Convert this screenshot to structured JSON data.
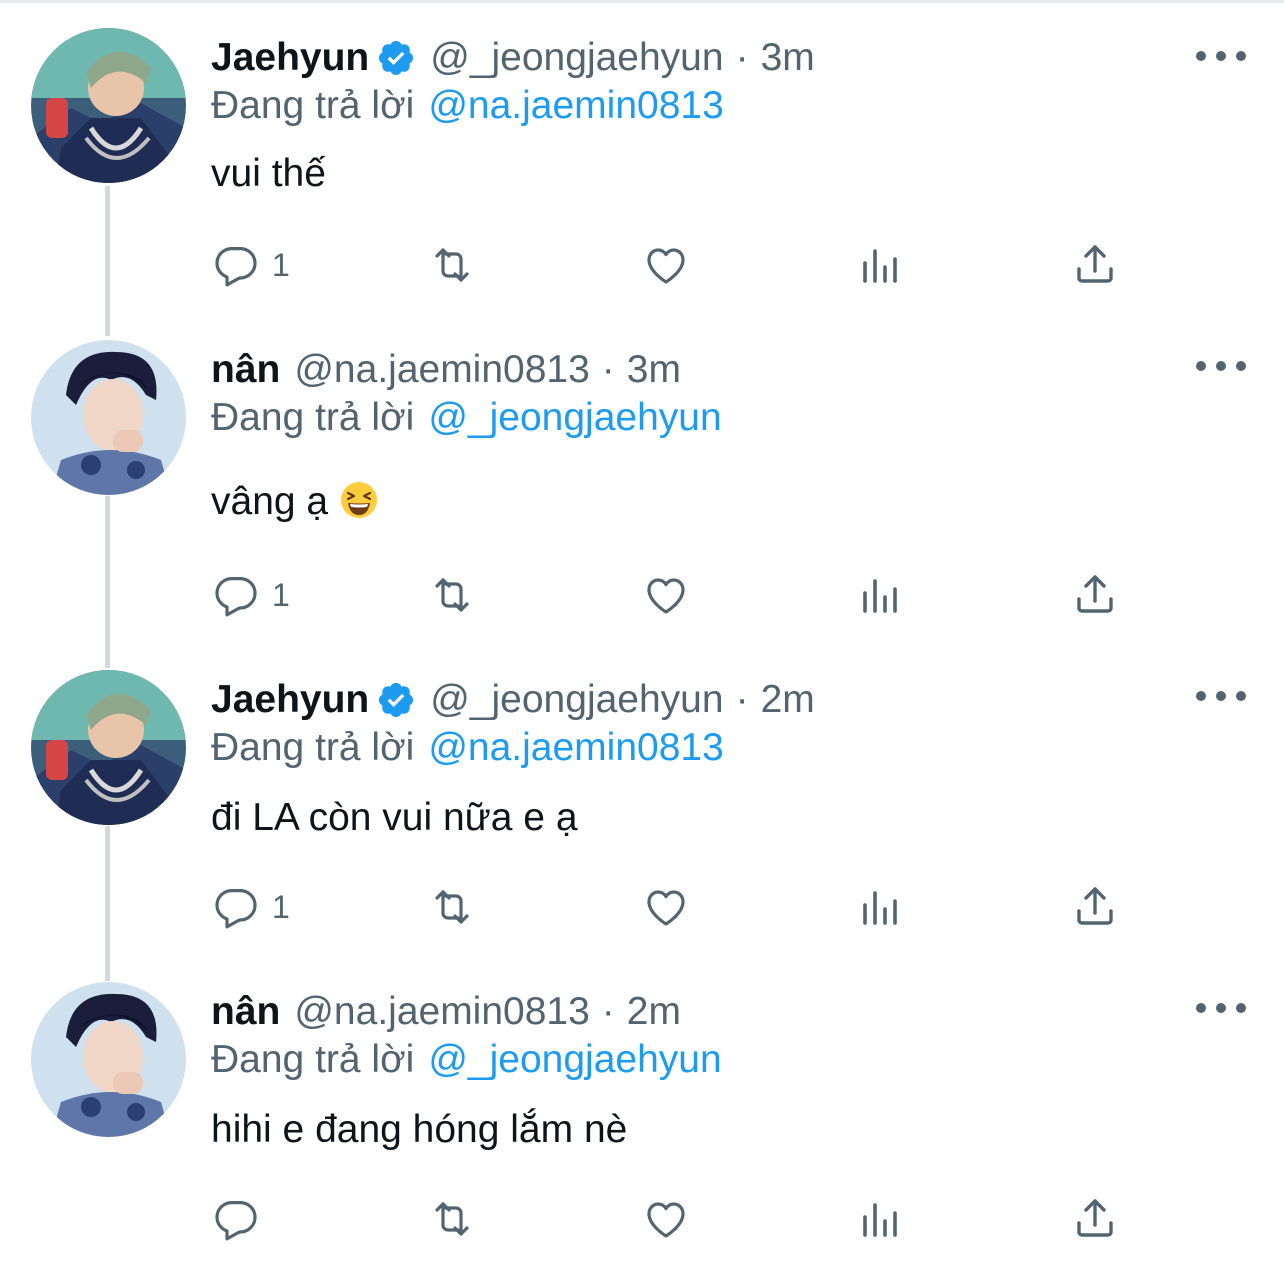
{
  "tweets": [
    {
      "display_name": "Jaehyun",
      "verified": true,
      "handle": "@_jeongjaehyun",
      "separator": "·",
      "time": "3m",
      "reply_prefix": "Đang trả lời",
      "reply_to": "@na.jaemin0813",
      "text": "vui thế",
      "reply_count": "1"
    },
    {
      "display_name": "nân",
      "verified": false,
      "handle": "@na.jaemin0813",
      "separator": "·",
      "time": "3m",
      "reply_prefix": "Đang trả lời",
      "reply_to": "@_jeongjaehyun",
      "text": "vâng ạ",
      "emoji": "grinning-squinting-face",
      "reply_count": "1"
    },
    {
      "display_name": "Jaehyun",
      "verified": true,
      "handle": "@_jeongjaehyun",
      "separator": "·",
      "time": "2m",
      "reply_prefix": "Đang trả lời",
      "reply_to": "@na.jaemin0813",
      "text": "đi LA còn vui nữa e ạ",
      "reply_count": "1"
    },
    {
      "display_name": "nân",
      "verified": false,
      "handle": "@na.jaemin0813",
      "separator": "·",
      "time": "2m",
      "reply_prefix": "Đang trả lời",
      "reply_to": "@_jeongjaehyun",
      "text": "hihi e đang hóng lắm nè",
      "reply_count": ""
    }
  ],
  "icons": {
    "reply": "reply-icon",
    "retweet": "retweet-icon",
    "like": "heart-icon",
    "analytics": "analytics-icon",
    "share": "share-icon",
    "more": "more-icon",
    "verified": "verified-badge-icon"
  },
  "colors": {
    "link": "#1d9bf0",
    "secondary_text": "#536471",
    "thread_line": "#d3d8dc",
    "verified": "#1d9bf0"
  }
}
